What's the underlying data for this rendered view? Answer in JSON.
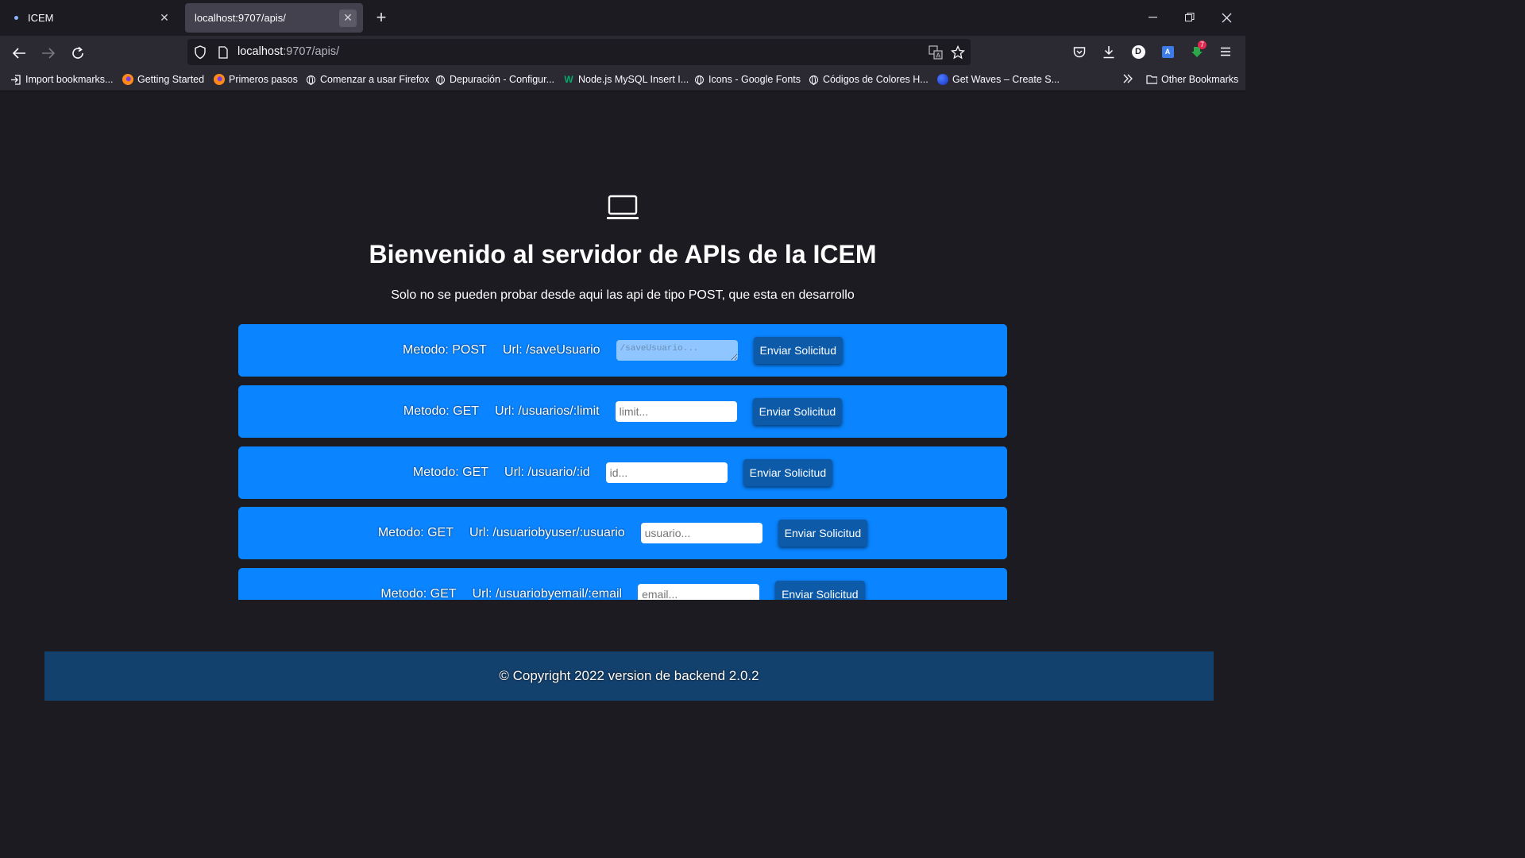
{
  "browser": {
    "tabs": [
      {
        "title": "ICEM",
        "active": false
      },
      {
        "title": "localhost:9707/apis/",
        "active": true
      }
    ],
    "url_host": "localhost",
    "url_rest": ":9707/apis/",
    "bookmarks": [
      {
        "label": "Import bookmarks...",
        "icon": "import-icon"
      },
      {
        "label": "Getting Started",
        "icon": "firefox-icon"
      },
      {
        "label": "Primeros pasos",
        "icon": "firefox-icon"
      },
      {
        "label": "Comenzar a usar Firefox",
        "icon": "globe-icon"
      },
      {
        "label": "Depuración - Configur...",
        "icon": "globe-icon"
      },
      {
        "label": "Node.js MySQL Insert I...",
        "icon": "w3schools-icon"
      },
      {
        "label": "Icons - Google Fonts",
        "icon": "globe-icon"
      },
      {
        "label": "Códigos de Colores H...",
        "icon": "globe-icon"
      },
      {
        "label": "Get Waves – Create S...",
        "icon": "wave-icon"
      }
    ],
    "other_bookmarks": "Other Bookmarks",
    "account_initial": "D",
    "extension_badge": "7"
  },
  "page": {
    "heading": "Bienvenido al servidor de APIs de la ICEM",
    "subtitle": "Solo no se pueden probar desde aqui las api de tipo POST, que esta en desarrollo",
    "endpoints": [
      {
        "method": "Metodo: POST",
        "url": "Url: /saveUsuario",
        "placeholder": "/saveUsuario...",
        "button": "Enviar Solicitud"
      },
      {
        "method": "Metodo: GET",
        "url": "Url: /usuarios/:limit",
        "placeholder": "limit...",
        "button": "Enviar Solicitud"
      },
      {
        "method": "Metodo: GET",
        "url": "Url: /usuario/:id",
        "placeholder": "id...",
        "button": "Enviar Solicitud"
      },
      {
        "method": "Metodo: GET",
        "url": "Url: /usuariobyuser/:usuario",
        "placeholder": "usuario...",
        "button": "Enviar Solicitud"
      },
      {
        "method": "Metodo: GET",
        "url": "Url: /usuariobyemail/:email",
        "placeholder": "email...",
        "button": "Enviar Solicitud"
      }
    ],
    "footer": "© Copyright 2022 version de backend 2.0.2"
  },
  "colors": {
    "row_bg": "#0a84ff",
    "button_bg": "#0c5aa8",
    "footer_bg": "#13416e",
    "page_bg": "#1c1b22"
  }
}
